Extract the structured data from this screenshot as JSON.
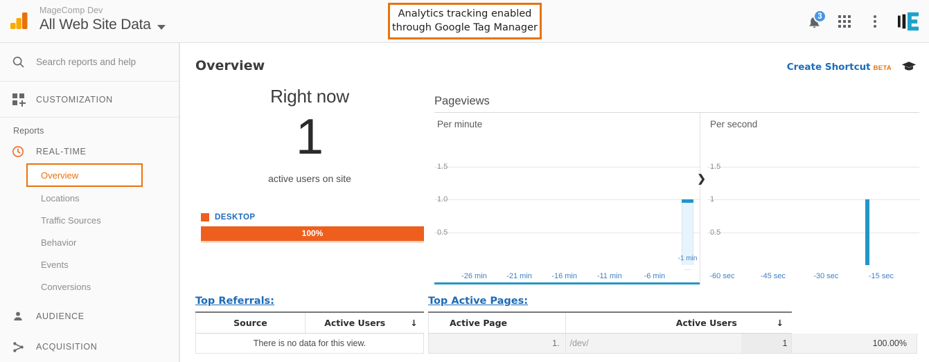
{
  "header": {
    "account_name": "MageComp Dev",
    "property_name": "All Web Site Data",
    "logo_icon": "google-analytics-logo",
    "caret_icon": "chevron-down-icon",
    "annotation": "Analytics tracking enabled through Google Tag Manager",
    "annotation_line1": "Analytics tracking enabled",
    "annotation_line2": "through Google Tag Manager",
    "annotation_border_color": "#e8730c",
    "icons": {
      "bell": "notifications-bell-icon",
      "bell_badge": "3",
      "apps": "apps-grid-icon",
      "more": "more-vertical-icon",
      "brand": "brand-mark-icon"
    }
  },
  "sidebar": {
    "search_placeholder": "Search reports and help",
    "search_icon": "search-icon",
    "customization": {
      "label": "CUSTOMIZATION",
      "icon": "customization-icon"
    },
    "reports_label": "Reports",
    "sections": [
      {
        "label": "REAL-TIME",
        "icon": "clock-icon",
        "items": [
          {
            "label": "Overview",
            "active": true
          },
          {
            "label": "Locations",
            "active": false
          },
          {
            "label": "Traffic Sources",
            "active": false
          },
          {
            "label": "Behavior",
            "active": false
          },
          {
            "label": "Events",
            "active": false
          },
          {
            "label": "Conversions",
            "active": false
          }
        ]
      },
      {
        "label": "AUDIENCE",
        "icon": "person-icon",
        "items": []
      },
      {
        "label": "ACQUISITION",
        "icon": "share-nodes-icon",
        "items": []
      }
    ],
    "active_color": "#e8730c"
  },
  "main": {
    "page_title": "Overview",
    "create_shortcut": "Create Shortcut",
    "beta_tag": "BETA",
    "cap_icon": "graduation-cap-icon",
    "right_now": {
      "title": "Right now",
      "count": "1",
      "subtitle": "active users on site",
      "legend_label": "DESKTOP",
      "legend_color": "#ee5f1e",
      "bar_percent": "100%"
    },
    "pageviews": {
      "title": "Pageviews",
      "minute_label": "Per minute",
      "second_label": "Per second",
      "scroll_icon": "chevron-right-icon",
      "highlight_label": "-1 min",
      "highlight_dots": "...."
    },
    "top_referrals": {
      "title": "Top Referrals:",
      "columns": [
        "Source",
        "Active Users"
      ],
      "sort_icon": "sort-desc-arrow-icon",
      "empty_message": "There is no data for this view."
    },
    "top_active_pages": {
      "title": "Top Active Pages:",
      "columns": [
        "Active Page",
        "Active Users"
      ],
      "sort_icon": "sort-desc-arrow-icon",
      "rows": [
        {
          "index": "1.",
          "page": "/dev/",
          "active_users": "1",
          "percent": "100.00%"
        }
      ]
    }
  },
  "chart_data": [
    {
      "type": "bar",
      "title": "Pageviews",
      "subtitle": "Per minute",
      "xlabel": "",
      "ylabel": "",
      "ylim": [
        0,
        2
      ],
      "yticks": [
        0.5,
        1.0,
        1.5
      ],
      "ytick_labels": [
        "0.5",
        "1.0",
        "1.5"
      ],
      "xticks": [
        -26,
        -21,
        -16,
        -11,
        -6,
        -1
      ],
      "xtick_labels": [
        "-26 min",
        "-21 min",
        "-16 min",
        "-11 min",
        "-6 min",
        "-1 min"
      ],
      "x": [
        -30,
        -29,
        -28,
        -27,
        -26,
        -25,
        -24,
        -23,
        -22,
        -21,
        -20,
        -19,
        -18,
        -17,
        -16,
        -15,
        -14,
        -13,
        -12,
        -11,
        -10,
        -9,
        -8,
        -7,
        -6,
        -5,
        -4,
        -3,
        -2,
        -1
      ],
      "values": [
        0,
        0,
        0,
        0,
        0,
        0,
        0,
        0,
        0,
        0,
        0,
        0,
        0,
        0,
        0,
        0,
        0,
        0,
        0,
        0,
        0,
        0,
        0,
        0,
        0,
        0,
        0,
        0,
        0,
        1
      ],
      "highlighted_index": 29,
      "grid": true,
      "bar_color": "#2196c8",
      "highlight_fill": "#e8f4fb"
    },
    {
      "type": "bar",
      "title": "Pageviews",
      "subtitle": "Per second",
      "xlabel": "",
      "ylabel": "",
      "ylim": [
        0,
        2
      ],
      "yticks": [
        0.5,
        1.0,
        1.5
      ],
      "ytick_labels": [
        "0.5",
        "1",
        "1.5"
      ],
      "xticks": [
        -60,
        -45,
        -30,
        -15
      ],
      "xtick_labels": [
        "-60 sec",
        "-45 sec",
        "-30 sec",
        "-15 sec"
      ],
      "x": [
        -18
      ],
      "values": [
        1
      ],
      "grid": true,
      "bar_color": "#2196c8"
    }
  ]
}
